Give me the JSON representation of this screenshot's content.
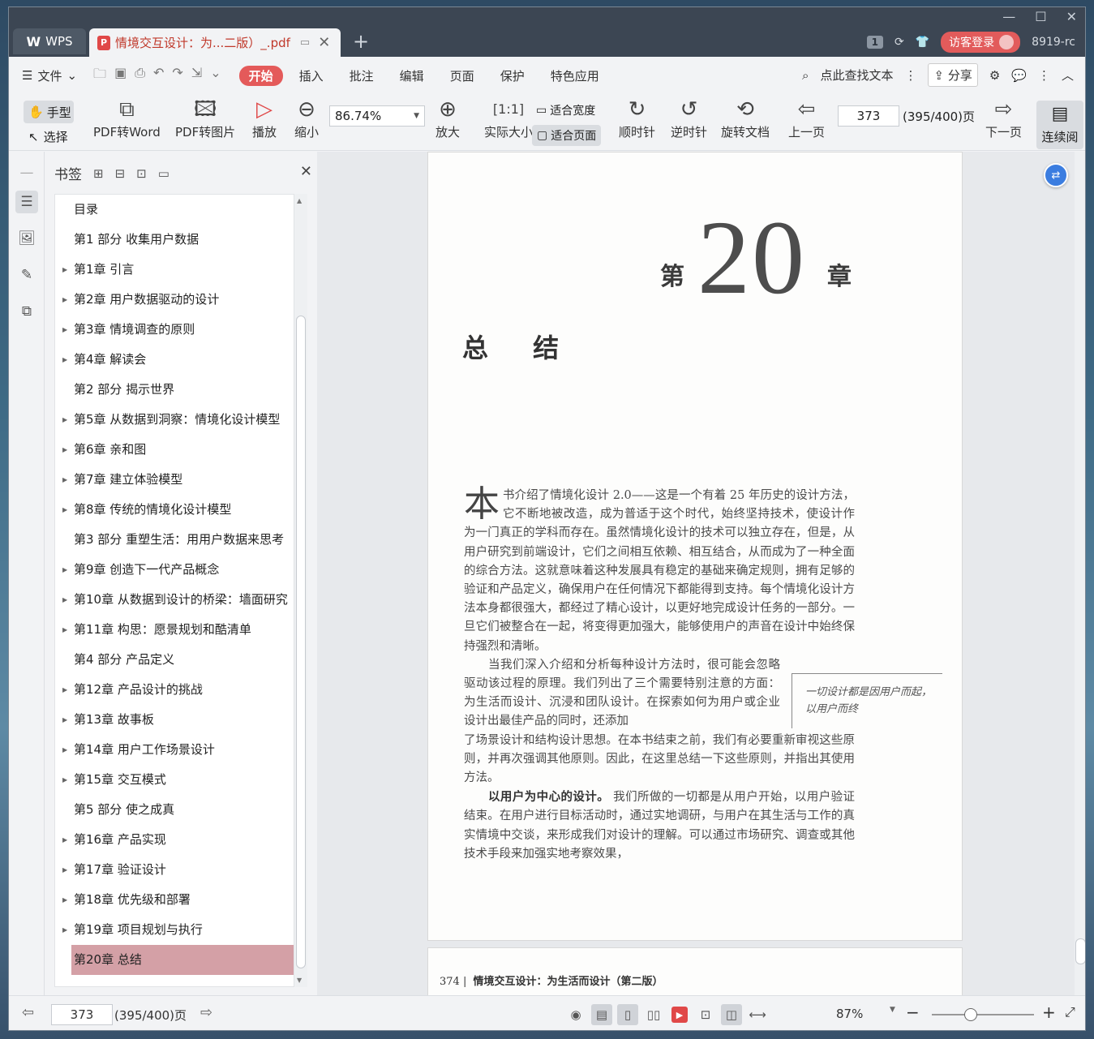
{
  "titlebar": {
    "wps_label": "WPS",
    "doc_tab_title": "情境交互设计：为...二版）_.pdf",
    "login_label": "访客登录",
    "user_id": "8919-rc",
    "tab_count_badge": "1"
  },
  "menubar": {
    "file_label": "文件",
    "items": [
      "开始",
      "插入",
      "批注",
      "编辑",
      "页面",
      "保护",
      "特色应用"
    ],
    "search_label": "点此查找文本",
    "share_label": "分享"
  },
  "toolbar": {
    "hand_label": "手型",
    "select_label": "选择",
    "pdf_to_word": "PDF转Word",
    "pdf_to_image": "PDF转图片",
    "play": "播放",
    "zoom_out": "缩小",
    "zoom_value": "86.74%",
    "zoom_in": "放大",
    "actual_size": "实际大小",
    "fit_width": "适合宽度",
    "fit_page": "适合页面",
    "clockwise": "顺时针",
    "counter_clockwise": "逆时针",
    "rotate_doc": "旋转文档",
    "prev_page": "上一页",
    "page_number": "373",
    "page_total": "(395/400)页",
    "next_page": "下一页",
    "continuous": "连续阅"
  },
  "bookmarks": {
    "title": "书签",
    "items": [
      {
        "label": "目录",
        "has_children": false
      },
      {
        "label": "第1 部分 收集用户数据",
        "has_children": false
      },
      {
        "label": "第1章 引言",
        "has_children": true
      },
      {
        "label": "第2章 用户数据驱动的设计",
        "has_children": true
      },
      {
        "label": "第3章 情境调查的原则",
        "has_children": true
      },
      {
        "label": "第4章 解读会",
        "has_children": true
      },
      {
        "label": "第2 部分 揭示世界",
        "has_children": false
      },
      {
        "label": "第5章 从数据到洞察：情境化设计模型",
        "has_children": true
      },
      {
        "label": "第6章 亲和图",
        "has_children": true
      },
      {
        "label": "第7章 建立体验模型",
        "has_children": true
      },
      {
        "label": "第8章 传统的情境化设计模型",
        "has_children": true
      },
      {
        "label": "第3 部分 重塑生活：用用户数据来思考",
        "has_children": false
      },
      {
        "label": "第9章 创造下一代产品概念",
        "has_children": true
      },
      {
        "label": "第10章 从数据到设计的桥梁：墙面研究",
        "has_children": true
      },
      {
        "label": "第11章 构思：愿景规划和酷清单",
        "has_children": true
      },
      {
        "label": "第4 部分 产品定义",
        "has_children": false
      },
      {
        "label": "第12章 产品设计的挑战",
        "has_children": true
      },
      {
        "label": "第13章 故事板",
        "has_children": true
      },
      {
        "label": "第14章 用户工作场景设计",
        "has_children": true
      },
      {
        "label": "第15章 交互模式",
        "has_children": true
      },
      {
        "label": "第5 部分 使之成真",
        "has_children": false
      },
      {
        "label": "第16章 产品实现",
        "has_children": true
      },
      {
        "label": "第17章 验证设计",
        "has_children": true
      },
      {
        "label": "第18章 优先级和部署",
        "has_children": true
      },
      {
        "label": "第19章 项目规划与执行",
        "has_children": true
      },
      {
        "label": "第20章 总结",
        "has_children": false,
        "selected": true
      }
    ]
  },
  "page": {
    "chapter_prefix": "第",
    "chapter_number": "20",
    "chapter_suffix": "章",
    "chapter_title": "总 结",
    "dropcap": "本",
    "para1": "书介绍了情境化设计 2.0——这是一个有着 25 年历史的设计方法，它不断地被改造，成为普适于这个时代，始终坚持技术，使设计作为一门真正的学科而存在。虽然情境化设计的技术可以独立存在，但是，从用户研究到前端设计，它们之间相互依赖、相互结合，从而成为了一种全面的综合方法。这就意味着这种发展具有稳定的基础来确定规则，拥有足够的验证和产品定义，确保用户在任何情况下都能得到支持。每个情境化设计方法本身都很强大，都经过了精心设计，以更好地完成设计任务的一部分。一旦它们被整合在一起，将变得更加强大，能够使用户的声音在设计中始终保持强烈和清晰。",
    "para2_narrow": "当我们深入介绍和分析每种设计方法时，很可能会忽略驱动该过程的原理。我们列出了三个需要特别注意的方面：为生活而设计、沉浸和团队设计。在探索如何为用户或企业设计出最佳产品的同时，还添加",
    "para2_rest": "了场景设计和结构设计思想。在本书结束之前，我们有必要重新审视这些原则，并再次强调其他原则。因此，在这里总结一下这些原则，并指出其使用方法。",
    "para3_bold": "以用户为中心的设计。",
    "para3": "我们所做的一切都是从用户开始，以用户验证结束。在用户进行目标活动时，通过实地调研，与用户在其生活与工作的真实情境中交谈，来形成我们对设计的理解。可以通过市场研究、调查或其他技术手段来加强实地考察效果，",
    "sidenote": "一切设计都是因用户而起，以用户而终",
    "footer_page": "374",
    "footer_title": "情境交互设计：为生活而设计（第二版）"
  },
  "statusbar": {
    "page_number": "373",
    "page_total": "(395/400)页",
    "zoom": "87%"
  }
}
